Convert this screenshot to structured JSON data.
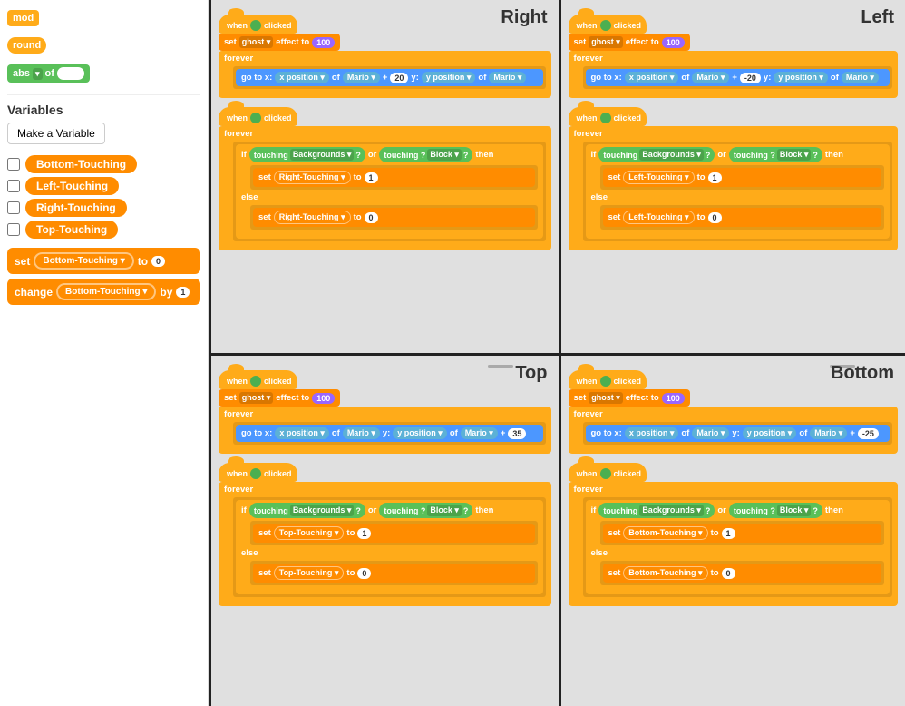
{
  "sidebar": {
    "blocks": {
      "mod_label": "mod",
      "round_label": "round",
      "abs_label": "abs",
      "of_label": "of"
    },
    "variables": {
      "title": "Variables",
      "make_button": "Make a Variable",
      "items": [
        {
          "name": "Bottom-Touching",
          "checked": false
        },
        {
          "name": "Left-Touching",
          "checked": false
        },
        {
          "name": "Right-Touching",
          "checked": false
        },
        {
          "name": "Top-Touching",
          "checked": false
        }
      ],
      "set_block": {
        "label": "set",
        "var": "Bottom-Touching",
        "to": "to",
        "value": "0"
      },
      "change_block": {
        "label": "change",
        "var": "Bottom-Touching",
        "by": "by",
        "value": "1"
      }
    }
  },
  "quadrants": {
    "right": {
      "label": "Right",
      "group1": {
        "hat": "when 🏁 clicked",
        "set": "set ghost ▾ effect to 100",
        "forever": "forever",
        "goto": "go to x: x position ▾ of Mario ▾ + 20 y: y position ▾ of Mario ▾"
      },
      "group2": {
        "hat": "when 🏁 clicked",
        "forever": "forever",
        "if_cond": "if touching Backgrounds ▾ ? or touching ? Block ▾ ? then",
        "set_true": "set Right-Touching ▾ to 1",
        "else": "else",
        "set_false": "set Right-Touching ▾ to 0"
      }
    },
    "left": {
      "label": "Left",
      "group1": {
        "hat": "when 🏁 clicked",
        "set": "set ghost ▾ effect to 100",
        "forever": "forever",
        "goto": "go to x: x position ▾ of Mario ▾ + -20 y: y position ▾ of Mario ▾"
      },
      "group2": {
        "hat": "when 🏁 clicked",
        "forever": "forever",
        "if_cond": "if touching Backgrounds ▾ ? or touching ? Block ▾ ? then",
        "set_true": "set Left-Touching ▾ to 1",
        "else": "else",
        "set_false": "set Left-Touching ▾ to 0"
      }
    },
    "top": {
      "label": "Top",
      "group1": {
        "hat": "when 🏁 clicked",
        "set": "set ghost ▾ effect to 100",
        "forever": "forever",
        "goto": "go to x: x position ▾ of Mario ▾ y: y position ▾ of Mario ▾ + 35"
      },
      "group2": {
        "hat": "when 🏁 clicked",
        "forever": "forever",
        "if_cond": "if touching Backgrounds ▾ ? or touching ? Block ▾ ? then",
        "set_true": "set Top-Touching ▾ to 1",
        "else": "else",
        "set_false": "set Top-Touching ▾ to 0"
      }
    },
    "bottom": {
      "label": "Bottom",
      "group1": {
        "hat": "when 🏁 clicked",
        "set": "set ghost ▾ effect to 100",
        "forever": "forever",
        "goto": "go to x: x position ▾ of Mario ▾ y: y position ▾ of Mario ▾ + -25"
      },
      "group2": {
        "hat": "when 🏁 clicked",
        "forever": "forever",
        "if_cond": "if touching Backgrounds ▾ ? or touching ? Block ▾ ? then",
        "set_true": "set Bottom-Touching ▾ to 1",
        "else": "else",
        "set_false": "set Bottom-Touching ▾ to 0"
      }
    }
  },
  "colors": {
    "hat": "#FFAB19",
    "orange": "#FF8C00",
    "blue": "#4C97FF",
    "green": "#59C059",
    "purple": "#9966FF",
    "teal": "#5CB1D6",
    "sidebar_bg": "#FFFFFF",
    "quadrant_bg": "#E0E0E0"
  }
}
